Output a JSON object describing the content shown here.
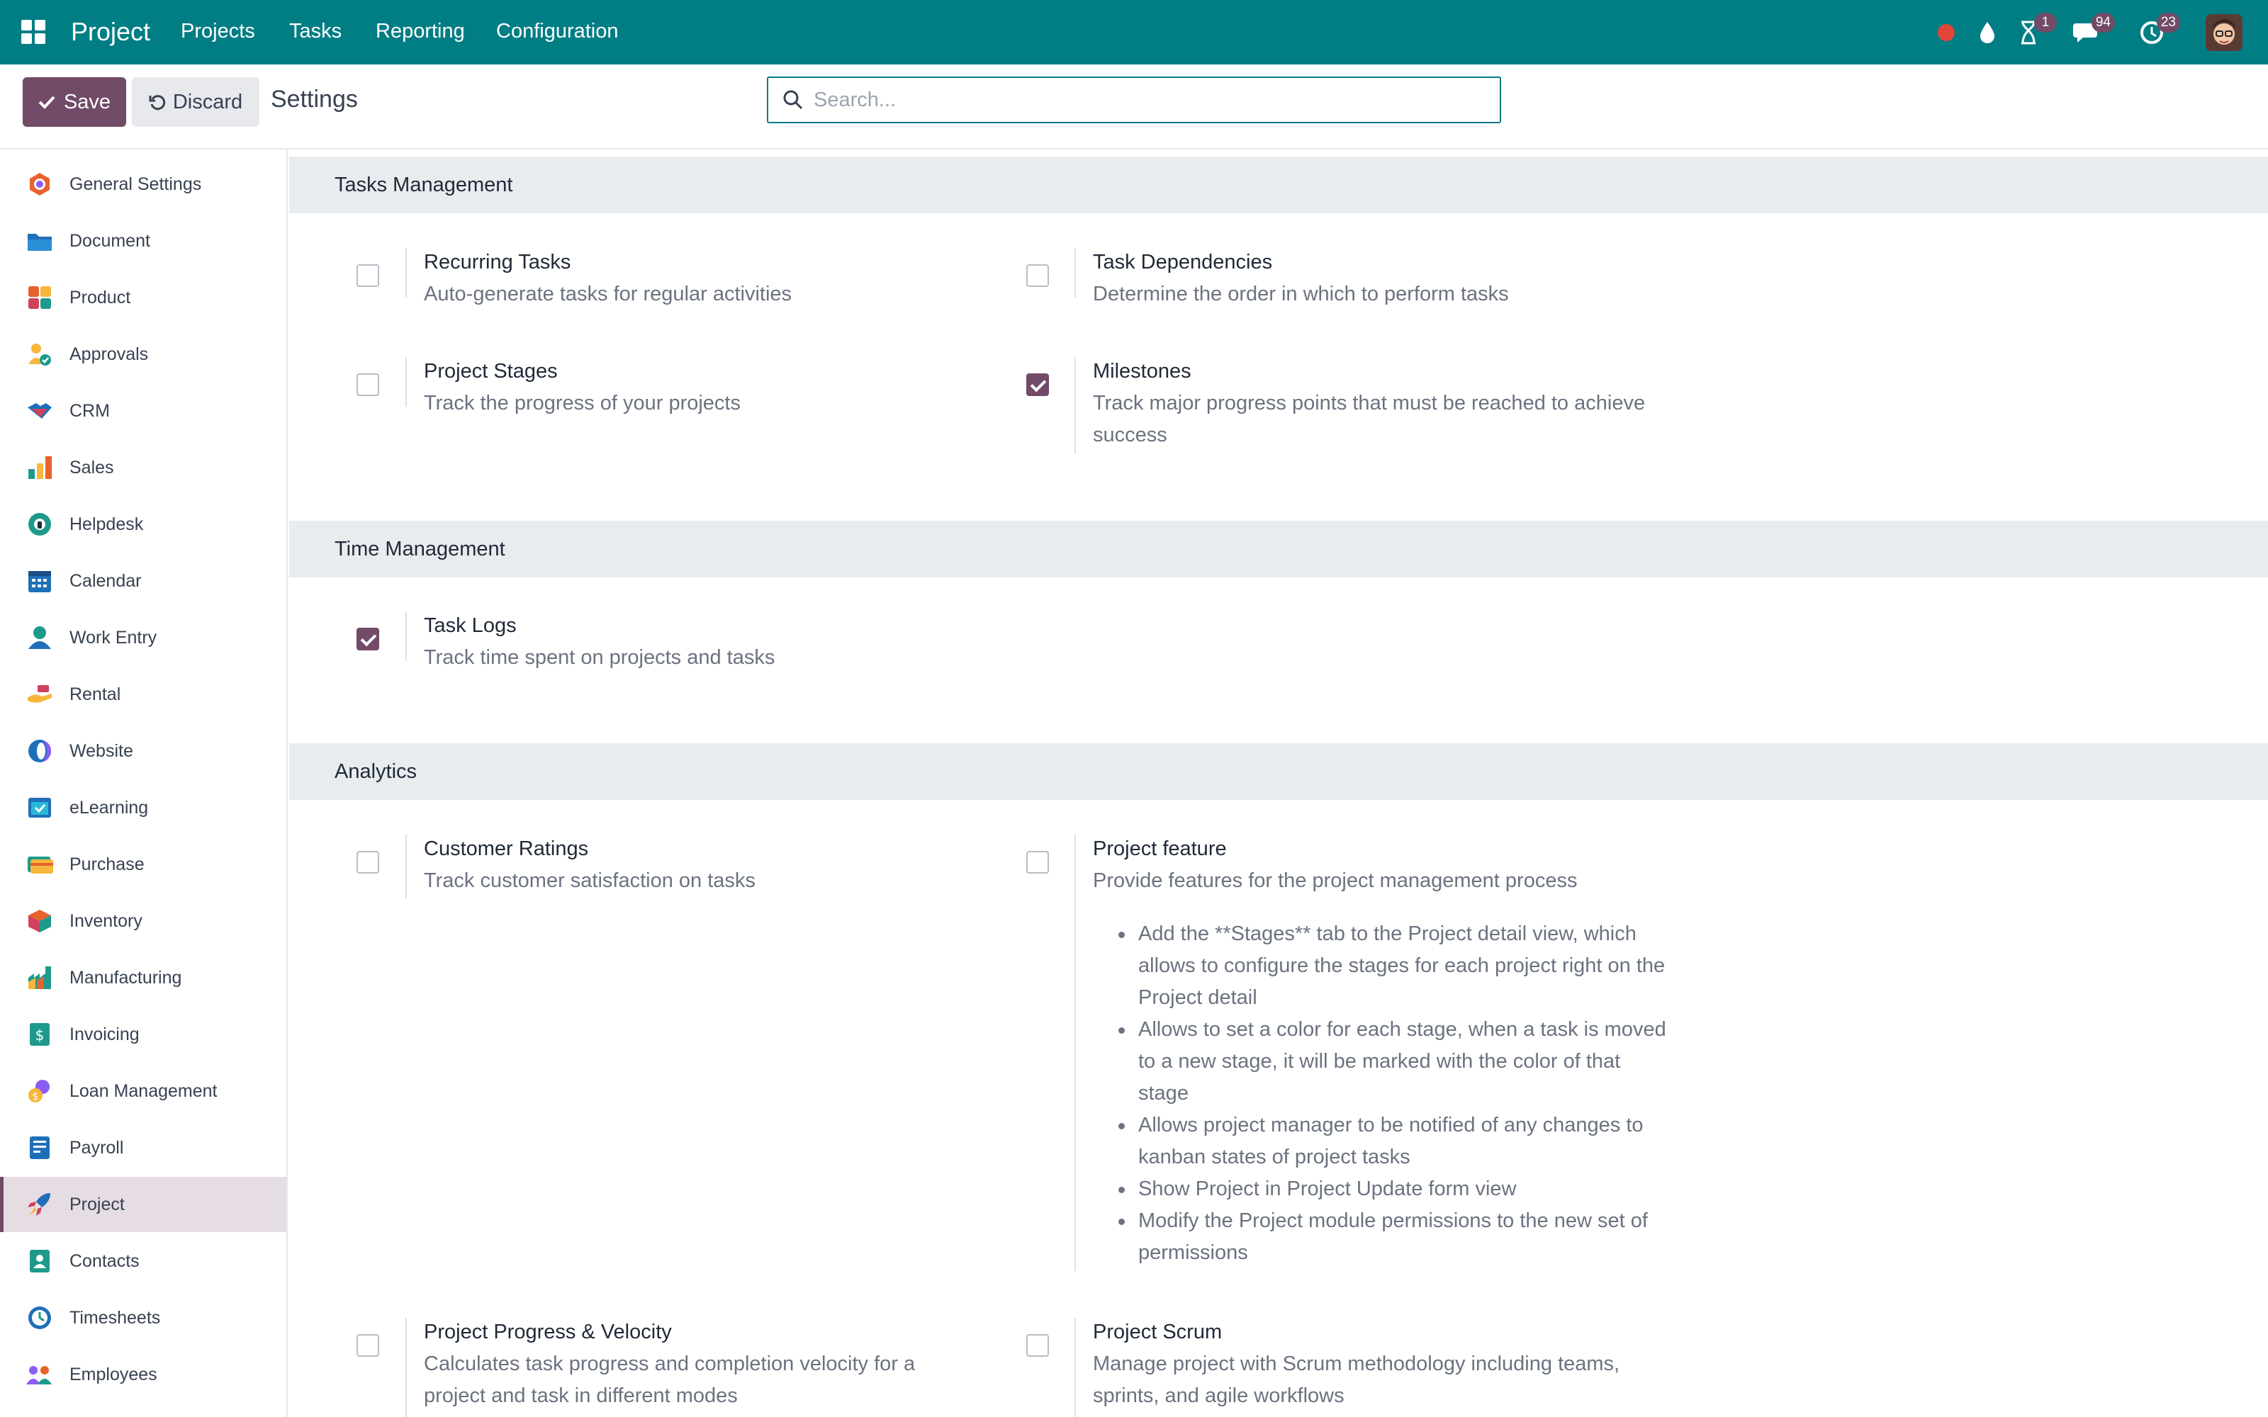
{
  "topbar": {
    "brand": "Project",
    "menu": [
      "Projects",
      "Tasks",
      "Reporting",
      "Configuration"
    ],
    "badges": {
      "activity": "1",
      "messages": "94",
      "updates": "23"
    },
    "accent_color": "#017e84"
  },
  "controls": {
    "save_label": "Save",
    "discard_label": "Discard",
    "title": "Settings",
    "search_placeholder": "Search..."
  },
  "sidebar": {
    "items": [
      {
        "label": "General Settings",
        "icon": "general-settings-icon"
      },
      {
        "label": "Document",
        "icon": "folder-icon"
      },
      {
        "label": "Product",
        "icon": "product-icon"
      },
      {
        "label": "Approvals",
        "icon": "approvals-icon"
      },
      {
        "label": "CRM",
        "icon": "crm-handshake-icon"
      },
      {
        "label": "Sales",
        "icon": "sales-chart-icon"
      },
      {
        "label": "Helpdesk",
        "icon": "helpdesk-icon"
      },
      {
        "label": "Calendar",
        "icon": "calendar-icon"
      },
      {
        "label": "Work Entry",
        "icon": "work-entry-icon"
      },
      {
        "label": "Rental",
        "icon": "rental-icon"
      },
      {
        "label": "Website",
        "icon": "website-icon"
      },
      {
        "label": "eLearning",
        "icon": "elearning-icon"
      },
      {
        "label": "Purchase",
        "icon": "purchase-card-icon"
      },
      {
        "label": "Inventory",
        "icon": "inventory-box-icon"
      },
      {
        "label": "Manufacturing",
        "icon": "manufacturing-icon"
      },
      {
        "label": "Invoicing",
        "icon": "invoicing-icon"
      },
      {
        "label": "Loan Management",
        "icon": "loan-icon"
      },
      {
        "label": "Payroll",
        "icon": "payroll-icon"
      },
      {
        "label": "Project",
        "icon": "project-rocket-icon",
        "active": true
      },
      {
        "label": "Contacts",
        "icon": "contacts-icon"
      },
      {
        "label": "Timesheets",
        "icon": "timesheets-icon"
      },
      {
        "label": "Employees",
        "icon": "employees-icon"
      }
    ]
  },
  "sections": {
    "tasks": {
      "title": "Tasks Management",
      "recurring": {
        "title": "Recurring Tasks",
        "desc": "Auto-generate tasks for regular activities",
        "checked": false
      },
      "dependencies": {
        "title": "Task Dependencies",
        "desc": "Determine the order in which to perform tasks",
        "checked": false
      },
      "stages": {
        "title": "Project Stages",
        "desc": "Track the progress of your projects",
        "checked": false
      },
      "milestones": {
        "title": "Milestones",
        "desc": "Track major progress points that must be reached to achieve success",
        "checked": true
      }
    },
    "time": {
      "title": "Time Management",
      "logs": {
        "title": "Task Logs",
        "desc": "Track time spent on projects and tasks",
        "checked": true
      }
    },
    "analytics": {
      "title": "Analytics",
      "ratings": {
        "title": "Customer Ratings",
        "desc": "Track customer satisfaction on tasks",
        "checked": false
      },
      "feature": {
        "title": "Project feature",
        "desc": "Provide features for the project management process",
        "checked": false,
        "bullets": [
          "Add the **Stages** tab to the Project detail view, which allows to configure the stages for each project right on the Project detail",
          "Allows to set a color for each stage, when a task is moved to a new stage, it will be marked with the color of that stage",
          "Allows project manager to be notified of any changes to kanban states of project tasks",
          "Show Project in Project Update form view",
          "Modify the Project module permissions to the new set of permissions"
        ]
      },
      "velocity": {
        "title": "Project Progress & Velocity",
        "desc": "Calculates task progress and completion velocity for a project and task in different modes",
        "checked": false
      },
      "scrum": {
        "title": "Project Scrum",
        "desc": "Manage project with Scrum methodology including teams, sprints, and agile workflows",
        "checked": false
      }
    }
  }
}
